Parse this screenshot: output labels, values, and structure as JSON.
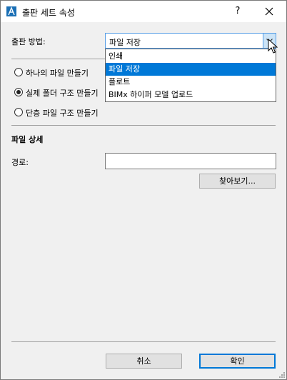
{
  "window": {
    "title": "출판 세트 속성",
    "help_label": "?"
  },
  "method": {
    "label": "출판 방법:",
    "selected": "파일 저장",
    "options": [
      "인쇄",
      "파일 저장",
      "플로트",
      "BIMx 하이퍼 모델 업로드"
    ],
    "highlighted_index": 1
  },
  "structure": {
    "options": [
      "하나의 파일 만들기",
      "실제 폴더 구조 만들기",
      "단층 파일 구조 만들기"
    ],
    "selected_index": 1
  },
  "file_details": {
    "heading": "파일 상세",
    "path_label": "경로:",
    "path_value": "",
    "browse_label": "찾아보기..."
  },
  "footer": {
    "cancel_label": "취소",
    "ok_label": "확인"
  },
  "colors": {
    "accent": "#0078d7",
    "app_icon": "#1a6fb5"
  }
}
